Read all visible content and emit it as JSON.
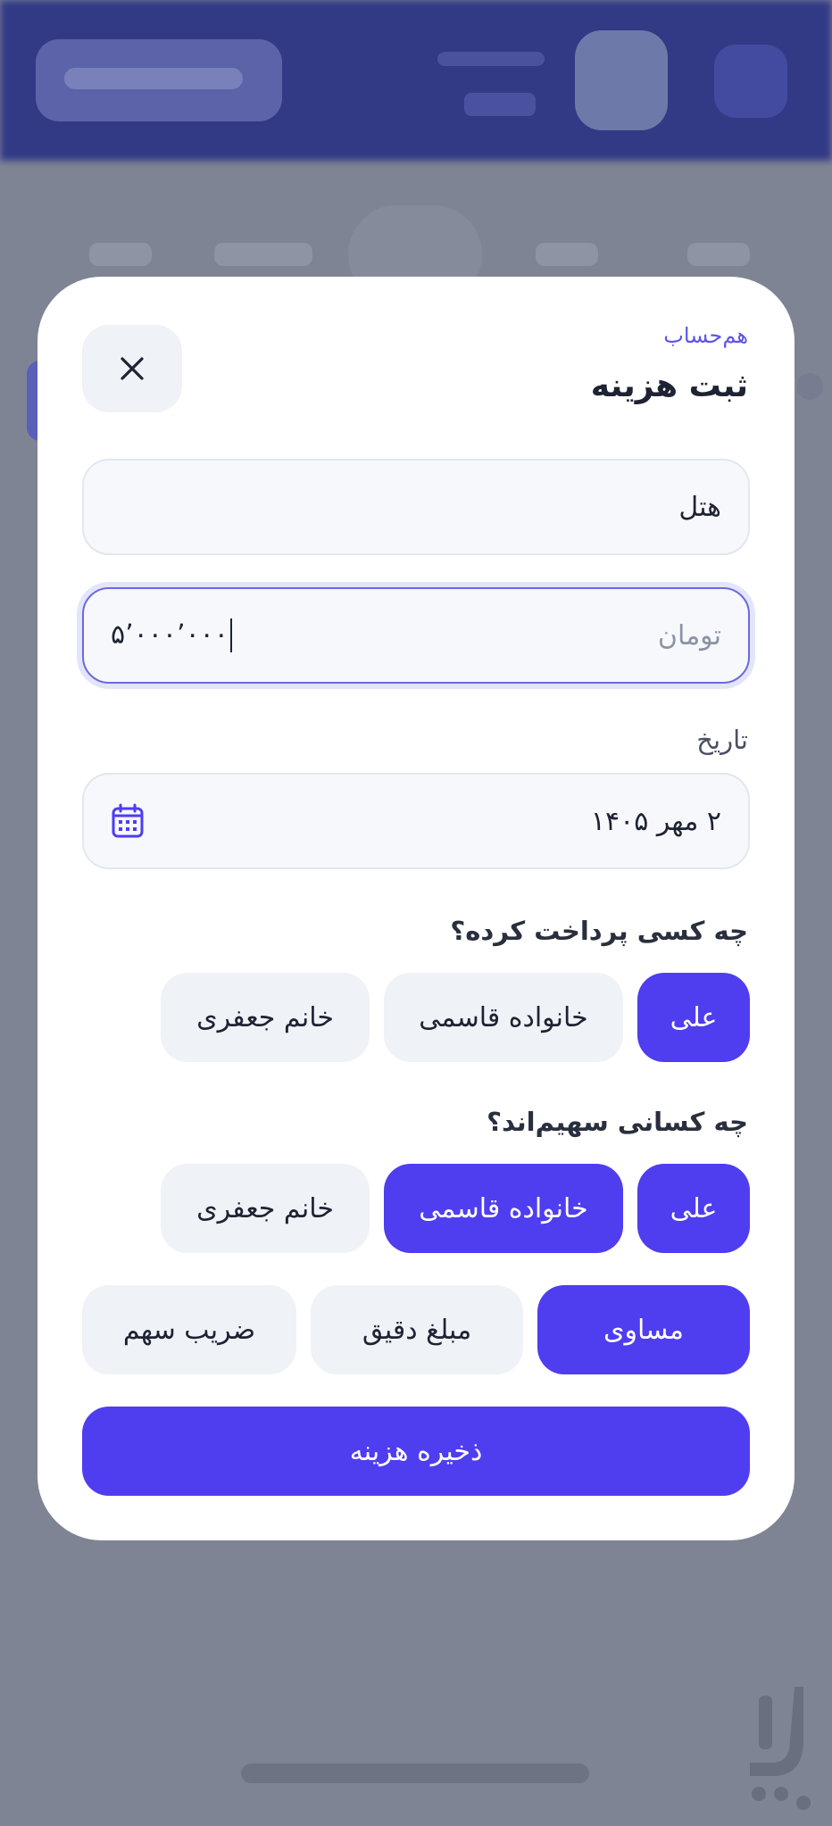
{
  "modal": {
    "brand": "هم‌حساب",
    "title": "ثبت هزینه",
    "close_icon": "close-icon"
  },
  "form": {
    "name_value": "هتل",
    "amount_placeholder": "تومان",
    "amount_value": "۵٬۰۰۰٬۰۰۰",
    "date_label": "تاریخ",
    "date_value": "۲ مهر ۱۴۰۵",
    "date_icon": "calendar-icon"
  },
  "payer": {
    "label": "چه کسی پرداخت کرده؟",
    "options": [
      "علی",
      "خانواده قاسمی",
      "خانم جعفری"
    ],
    "selected": "علی"
  },
  "share": {
    "label": "چه کسانی سهیم‌اند؟",
    "options": [
      "علی",
      "خانواده قاسمی",
      "خانم جعفری"
    ],
    "selected": [
      "علی",
      "خانواده قاسمی"
    ]
  },
  "split_mode": {
    "options": [
      "مساوی",
      "مبلغ دقیق",
      "ضریب سهم"
    ],
    "selected": "مساوی"
  },
  "save_label": "ذخیره هزینه",
  "colors": {
    "accent": "#4f3df0",
    "brand_text": "#5b55e6",
    "chip_bg": "#eff2f7",
    "overlay_bg": "#7f8494"
  }
}
